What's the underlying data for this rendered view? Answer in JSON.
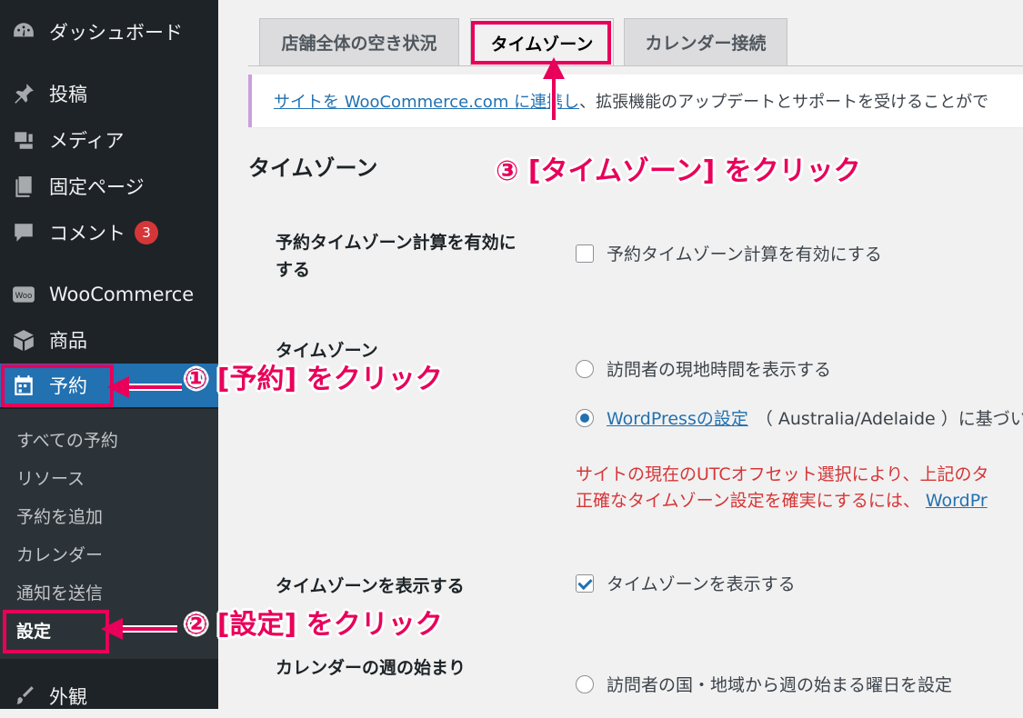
{
  "sidebar": {
    "items": [
      {
        "label": "ダッシュボード",
        "icon": "dashboard-icon"
      },
      {
        "label": "投稿",
        "icon": "pin-icon"
      },
      {
        "label": "メディア",
        "icon": "media-icon"
      },
      {
        "label": "固定ページ",
        "icon": "page-icon"
      },
      {
        "label": "コメント",
        "icon": "comment-icon",
        "badge": "3"
      },
      {
        "label": "WooCommerce",
        "icon": "woo-icon"
      },
      {
        "label": "商品",
        "icon": "box-icon"
      },
      {
        "label": "予約",
        "icon": "calendar-icon"
      },
      {
        "label": "外観",
        "icon": "brush-icon"
      }
    ],
    "submenu": [
      "すべての予約",
      "リソース",
      "予約を追加",
      "カレンダー",
      "通知を送信",
      "設定"
    ]
  },
  "tabs": [
    "店舗全体の空き状況",
    "タイムゾーン",
    "カレンダー接続"
  ],
  "notice": {
    "link": "サイトを WooCommerce.com に連携し",
    "text": "、拡張機能のアップデートとサポートを受けることがで"
  },
  "section_title": "タイムゾーン",
  "fields": {
    "enable": {
      "label_line1": "予約タイムゾーン計算を有効に",
      "label_line2": "する",
      "checkbox_label": "予約タイムゾーン計算を有効にする"
    },
    "timezone": {
      "label": "タイムゾーン",
      "radio1": "訪問者の現地時間を表示する",
      "radio2_link": "WordPressの設定",
      "radio2_rest": "（ Australia/Adelaide ）に基づい",
      "warning_line1": "サイトの現在のUTCオフセット選択により、上記のタ",
      "warning_line2_text": "正確なタイムゾーン設定を確実にするには、",
      "warning_line2_link": "WordPr"
    },
    "display": {
      "label": "タイムゾーンを表示する",
      "checkbox_label": "タイムゾーンを表示する"
    },
    "week_start": {
      "label": "カレンダーの週の始まり",
      "radio1": "訪問者の国・地域から週の始まる曜日を設定"
    }
  },
  "annotations": {
    "step1": "① [予約] をクリック",
    "step2": "② [設定] をクリック",
    "step3": "③ [タイムゾーン] をクリック"
  },
  "colors": {
    "accent": "#2271b1",
    "annotation": "#e8005a",
    "warning": "#d63638",
    "sidebar": "#1d2327"
  }
}
